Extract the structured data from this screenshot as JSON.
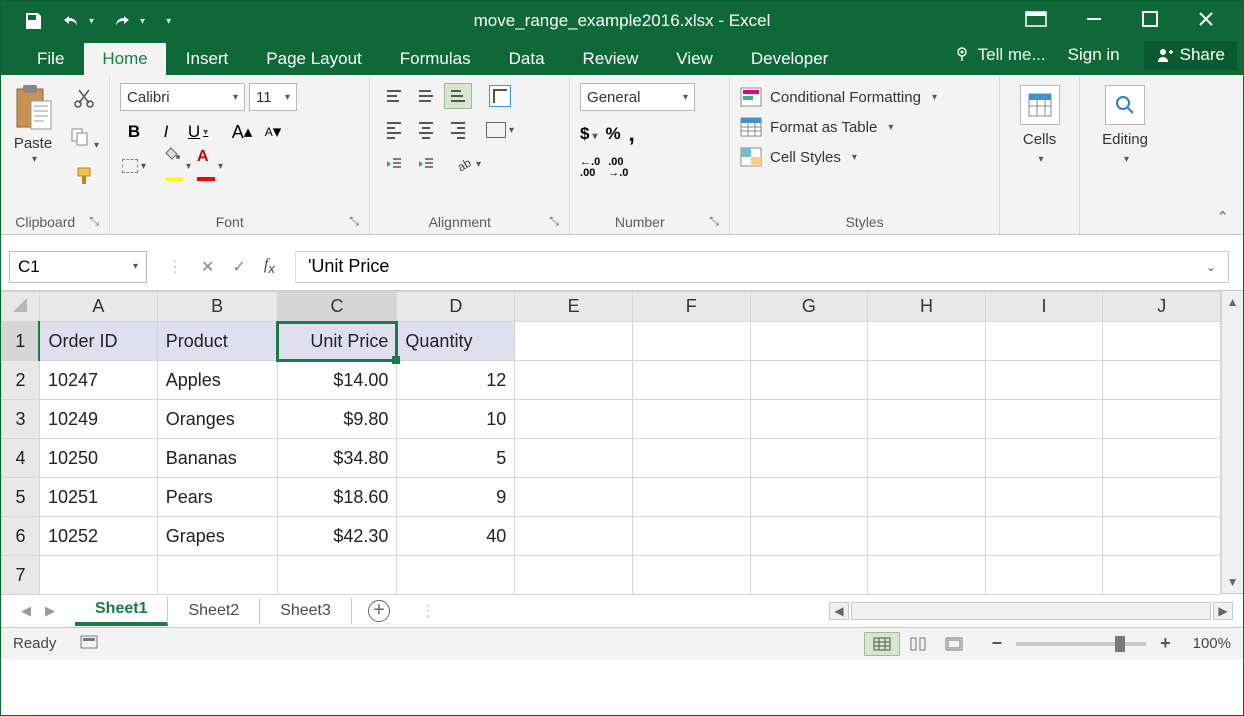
{
  "titlebar": {
    "title": "move_range_example2016.xlsx - Excel"
  },
  "tabs": {
    "file": "File",
    "home": "Home",
    "insert": "Insert",
    "page_layout": "Page Layout",
    "formulas": "Formulas",
    "data": "Data",
    "review": "Review",
    "view": "View",
    "developer": "Developer",
    "tell_me": "Tell me...",
    "sign_in": "Sign in",
    "share": "Share"
  },
  "ribbon": {
    "clipboard": {
      "paste": "Paste",
      "label": "Clipboard"
    },
    "font": {
      "name": "Calibri",
      "size": "11",
      "label": "Font"
    },
    "alignment": {
      "label": "Alignment"
    },
    "number": {
      "format": "General",
      "label": "Number"
    },
    "styles": {
      "cond": "Conditional Formatting",
      "table": "Format as Table",
      "cell": "Cell Styles",
      "label": "Styles"
    },
    "cells": {
      "label": "Cells"
    },
    "editing": {
      "label": "Editing"
    }
  },
  "formula": {
    "name_box": "C1",
    "value": "'Unit Price"
  },
  "columns": [
    "A",
    "B",
    "C",
    "D",
    "E",
    "F",
    "G",
    "H",
    "I",
    "J"
  ],
  "rows": [
    "1",
    "2",
    "3",
    "4",
    "5",
    "6",
    "7"
  ],
  "selected_cell": "C1",
  "selected_col_index": 2,
  "headers": [
    "Order ID",
    "Product",
    "Unit Price",
    "Quantity"
  ],
  "data_rows": [
    {
      "order_id": "10247",
      "product": "Apples",
      "price": "$14.00",
      "qty": "12"
    },
    {
      "order_id": "10249",
      "product": "Oranges",
      "price": "$9.80",
      "qty": "10"
    },
    {
      "order_id": "10250",
      "product": "Bananas",
      "price": "$34.80",
      "qty": "5"
    },
    {
      "order_id": "10251",
      "product": "Pears",
      "price": "$18.60",
      "qty": "9"
    },
    {
      "order_id": "10252",
      "product": "Grapes",
      "price": "$42.30",
      "qty": "40"
    }
  ],
  "sheets": {
    "active": "Sheet1",
    "s2": "Sheet2",
    "s3": "Sheet3"
  },
  "status": {
    "ready": "Ready",
    "zoom": "100%"
  }
}
